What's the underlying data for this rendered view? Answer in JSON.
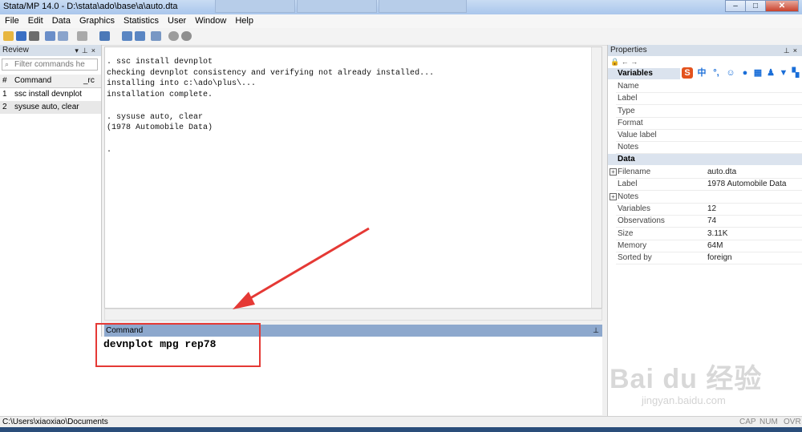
{
  "window": {
    "title": "Stata/MP 14.0 - D:\\stata\\ado\\base\\a\\auto.dta"
  },
  "menu": [
    "File",
    "Edit",
    "Data",
    "Graphics",
    "Statistics",
    "User",
    "Window",
    "Help"
  ],
  "review": {
    "title": "Review",
    "filter_placeholder": "Filter commands he",
    "col_num": "#",
    "col_command": "Command",
    "col_rc": "_rc",
    "rows": [
      {
        "num": "1",
        "command": "ssc install devnplot"
      },
      {
        "num": "2",
        "command": "sysuse auto, clear"
      }
    ]
  },
  "results": {
    "text": ". ssc install devnplot\nchecking devnplot consistency and verifying not already installed...\ninstalling into c:\\ado\\plus\\...\ninstallation complete.\n\n. sysuse auto, clear\n(1978 Automobile Data)\n\n."
  },
  "command": {
    "title": "Command",
    "value": "devnplot mpg rep78"
  },
  "properties": {
    "title": "Properties",
    "variables_label": "Variables",
    "variables": [
      "Name",
      "Label",
      "Type",
      "Format",
      "Value label",
      "Notes"
    ],
    "data_label": "Data",
    "data": [
      {
        "key": "Filename",
        "value": "auto.dta"
      },
      {
        "key": "Label",
        "value": "1978 Automobile Data"
      },
      {
        "key": "Notes",
        "value": ""
      },
      {
        "key": "Variables",
        "value": "12"
      },
      {
        "key": "Observations",
        "value": "74"
      },
      {
        "key": "Size",
        "value": "3.11K"
      },
      {
        "key": "Memory",
        "value": "64M"
      },
      {
        "key": "Sorted by",
        "value": "foreign"
      }
    ]
  },
  "status": {
    "path": "C:\\Users\\xiaoxiao\\Documents",
    "cap": "CAP",
    "num": "NUM",
    "ovr": "OVR"
  },
  "ime": {
    "s": "S",
    "zh": "中"
  },
  "watermark": {
    "main": "Bai du 经验",
    "url": "jingyan.baidu.com"
  }
}
